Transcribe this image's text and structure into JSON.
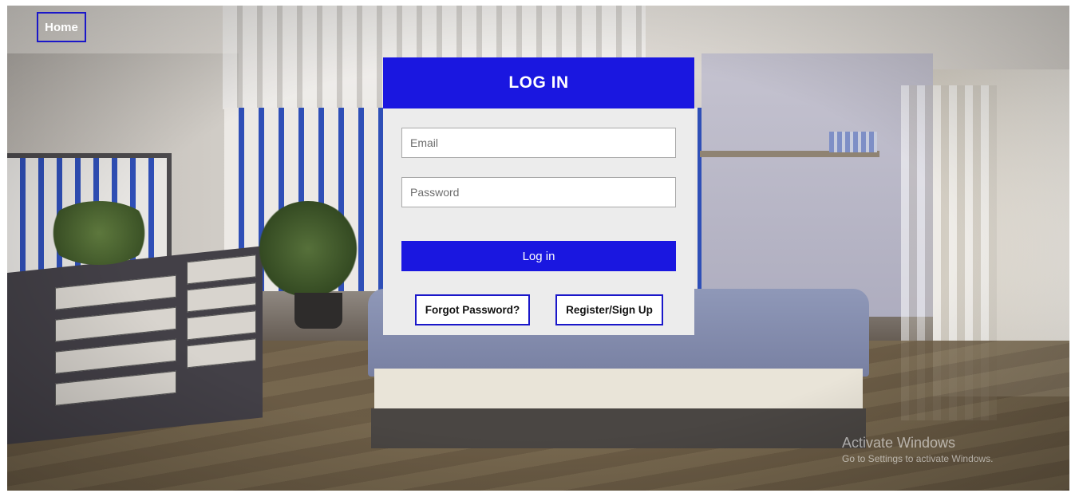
{
  "nav": {
    "home_label": "Home"
  },
  "login": {
    "title": "LOG IN",
    "email_placeholder": "Email",
    "password_placeholder": "Password",
    "submit_label": "Log in",
    "forgot_label": "Forgot Password?",
    "register_label": "Register/Sign Up"
  },
  "watermark": {
    "line1": "Activate Windows",
    "line2": "Go to Settings to activate Windows."
  },
  "colors": {
    "accent": "#1a17e0",
    "card_bg": "#ececec"
  }
}
